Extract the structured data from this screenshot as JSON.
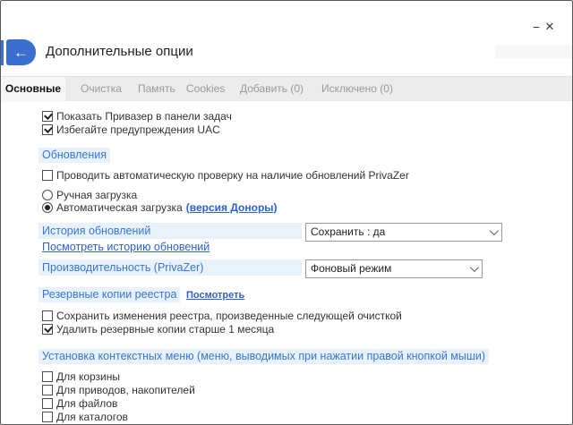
{
  "titlebar": {
    "minimize_glyph": "−",
    "close_glyph": "✕"
  },
  "header": {
    "back_glyph": "←",
    "title": "Дополнительные опции"
  },
  "tabs": {
    "items": [
      {
        "label": "Основные",
        "active": true
      },
      {
        "label": "Очистка",
        "active": false
      },
      {
        "label": "Память",
        "active": false
      },
      {
        "label": "Cookies",
        "active": false
      },
      {
        "label": "Добавить (0)",
        "active": false
      },
      {
        "label": "Исключено (0)",
        "active": false
      }
    ]
  },
  "accent_colors": {
    "heading_blue": "#3478d6",
    "highlight_bg": "#e9f1fb",
    "back_button_blue": "#3a6fd0",
    "link_blue": "#2e62d0"
  },
  "main": {
    "top_checks": [
      {
        "label": "Показать Привазер в панели задач",
        "checked": true
      },
      {
        "label": "Избегайте предупреждения UAC",
        "checked": true
      }
    ],
    "updates": {
      "heading": "Обновления",
      "auto_check": {
        "label": "Проводить автоматическую проверку на наличие обновлений PrivaZer",
        "checked": false
      },
      "manual_radio": {
        "label": "Ручная загрузка",
        "selected": false
      },
      "auto_radio": {
        "label": "Автоматическая загрузка",
        "selected": true,
        "link": "(версия Доноры)"
      },
      "history_label": "История обновлений",
      "history_value": "Сохранить : да",
      "history_link": "Посмотреть историю обновений",
      "performance_label": "Производительность (PrivaZer)",
      "performance_value": "Фоновый режим"
    },
    "registry": {
      "heading": "Резервные копии реестра",
      "view_link": "Посмотреть",
      "checks": [
        {
          "label": "Сохранить изменения реестра, произведенные следующей очисткой",
          "checked": false
        },
        {
          "label": "Удалить резервные копии старше 1 месяца",
          "checked": true
        }
      ]
    },
    "context_menu": {
      "heading": "Установка контекстных меню (меню, выводимых при нажатии правой кнопкой мыши)",
      "checks": [
        {
          "label": "Для корзины",
          "checked": false
        },
        {
          "label": "Для приводов, накопителей",
          "checked": false
        },
        {
          "label": "Для файлов",
          "checked": false
        },
        {
          "label": "Для каталогов",
          "checked": false
        }
      ]
    }
  }
}
